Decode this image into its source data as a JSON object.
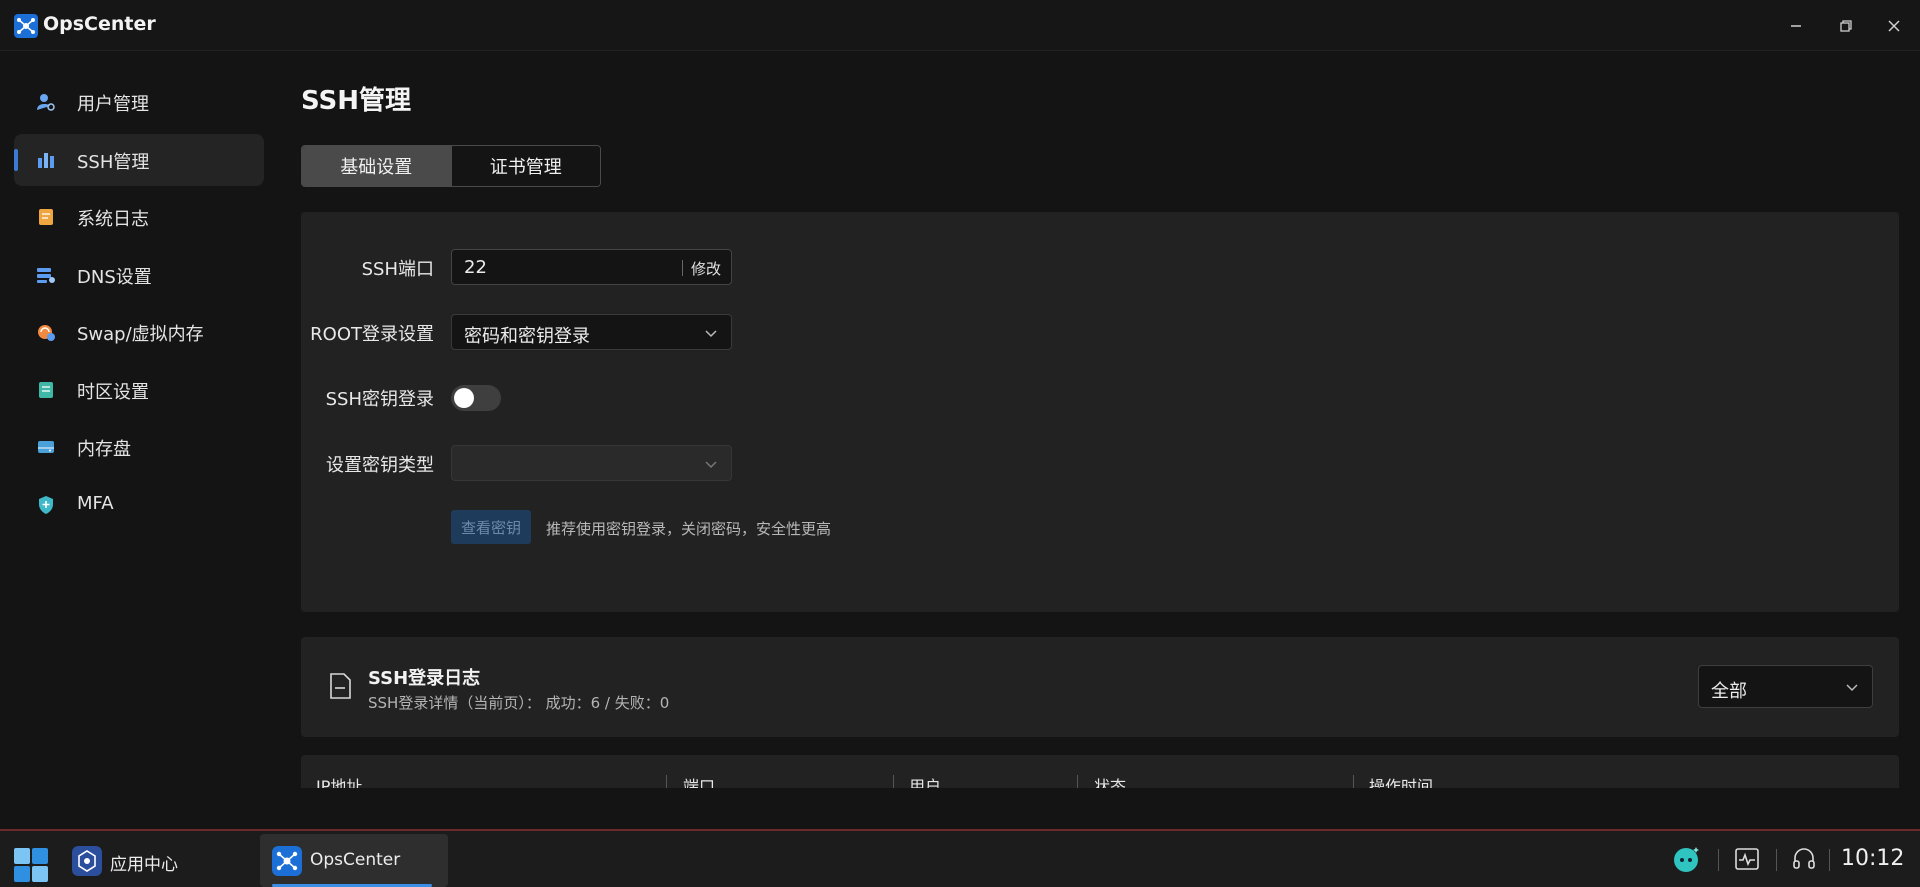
{
  "window": {
    "title": "OpsCenter",
    "controls": {
      "minimize": "minimize-icon",
      "restore": "restore-icon",
      "close": "close-icon"
    }
  },
  "sidebar": {
    "items": [
      {
        "label": "用户管理",
        "icon": "user-settings-icon",
        "active": false
      },
      {
        "label": "SSH管理",
        "icon": "ssh-icon",
        "active": true
      },
      {
        "label": "系统日志",
        "icon": "log-icon",
        "active": false
      },
      {
        "label": "DNS设置",
        "icon": "dns-icon",
        "active": false
      },
      {
        "label": "Swap/虚拟内存",
        "icon": "swap-icon",
        "active": false
      },
      {
        "label": "时区设置",
        "icon": "timezone-icon",
        "active": false
      },
      {
        "label": "内存盘",
        "icon": "ramdisk-icon",
        "active": false
      },
      {
        "label": "MFA",
        "icon": "shield-icon",
        "active": false
      }
    ]
  },
  "main": {
    "title": "SSH管理",
    "tabs": [
      {
        "label": "基础设置",
        "selected": true
      },
      {
        "label": "证书管理",
        "selected": false
      }
    ],
    "settings": {
      "ssh_port": {
        "label": "SSH端口",
        "value": "22",
        "action": "修改"
      },
      "root_login": {
        "label": "ROOT登录设置",
        "value": "密码和密钥登录"
      },
      "key_login": {
        "label": "SSH密钥登录",
        "enabled": false
      },
      "key_type": {
        "label": "设置密钥类型",
        "value": ""
      },
      "view_key_button": "查看密钥",
      "hint": "推荐使用密钥登录，关闭密码，安全性更高"
    },
    "log": {
      "title": "SSH登录日志",
      "subtitle": "SSH登录详情（当前页）： 成功：6 / 失败：0",
      "filter_value": "全部",
      "columns": [
        "IP地址",
        "端口",
        "用户",
        "状态",
        "操作时间"
      ]
    }
  },
  "taskbar": {
    "items": [
      {
        "label": "应用中心",
        "active": false
      },
      {
        "label": "OpsCenter",
        "active": true
      }
    ],
    "clock": "10:12"
  },
  "colors": {
    "accent": "#3a7bd5",
    "background": "#141414",
    "card": "#222222"
  }
}
